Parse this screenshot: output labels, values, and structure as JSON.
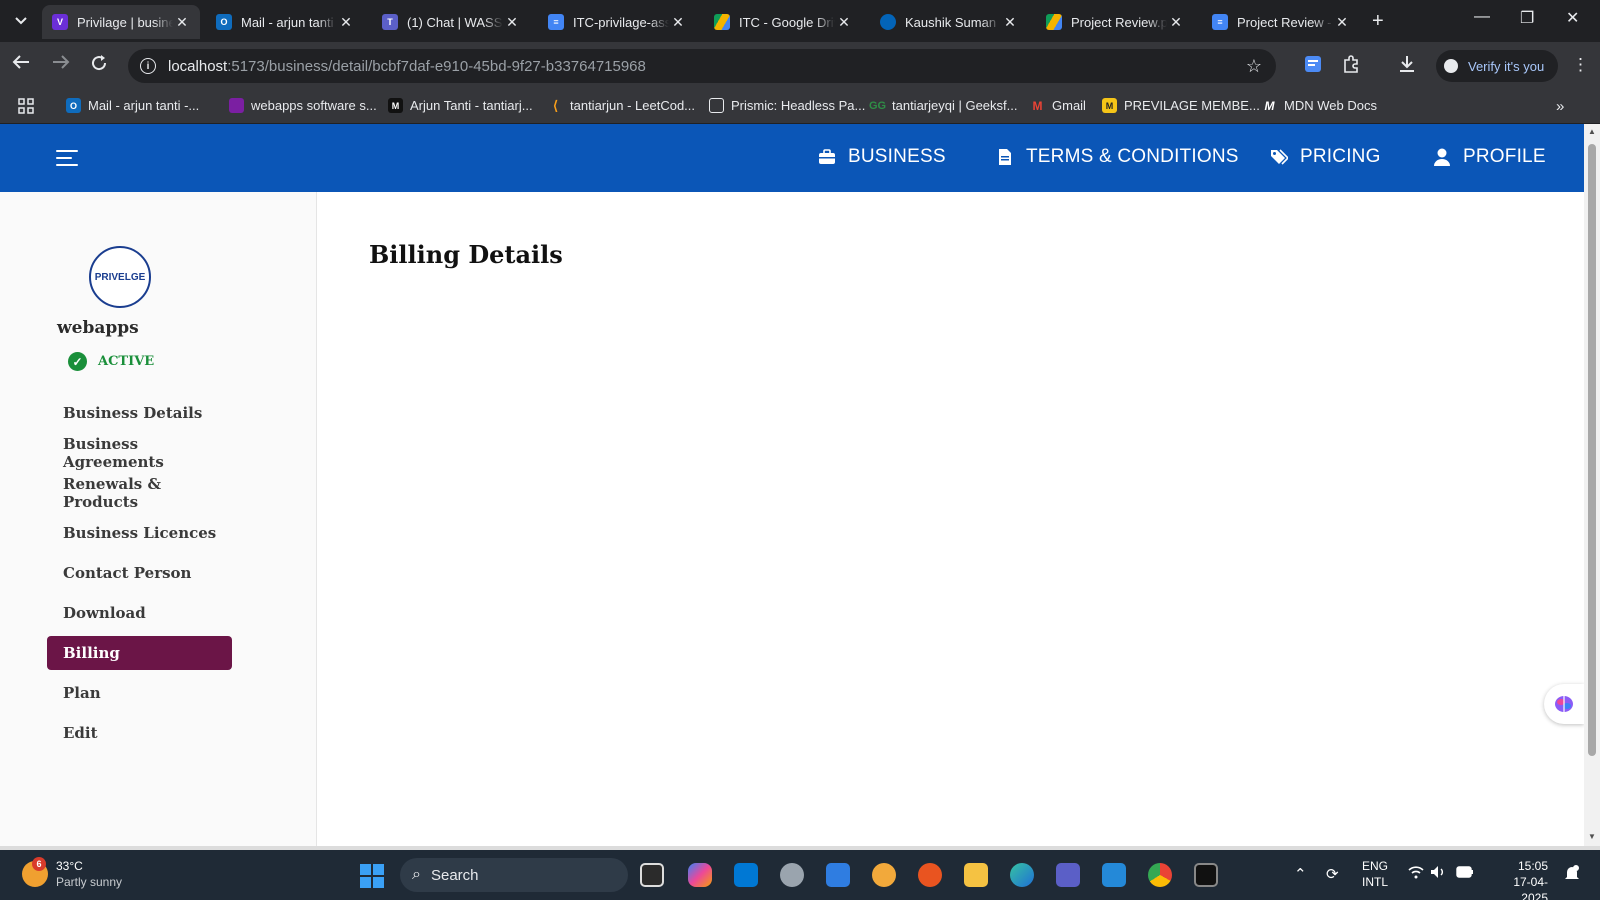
{
  "browser": {
    "tabs": [
      {
        "title": "Privilage | busine",
        "active": true,
        "icon": "vite-icon"
      },
      {
        "title": "Mail - arjun tanti",
        "icon": "outlook-icon"
      },
      {
        "title": "(1) Chat | WASS",
        "icon": "teams-icon"
      },
      {
        "title": "ITC-privilage-ass",
        "icon": "docs-icon"
      },
      {
        "title": "ITC - Google Driv",
        "icon": "drive-icon"
      },
      {
        "title": "Kaushik Suman",
        "icon": "onedrive-icon"
      },
      {
        "title": "Project Review.p",
        "icon": "drive-icon"
      },
      {
        "title": "Project Review -",
        "icon": "docs-icon"
      }
    ],
    "url_host": "localhost",
    "url_path": ":5173/business/detail/bcbf7daf-e910-45bd-9f27-b33764715968",
    "verify_label": "Verify it's you",
    "bookmarks": [
      "Mail - arjun tanti -...",
      "webapps software s...",
      "Arjun Tanti - tantiarj...",
      "tantiarjun - LeetCod...",
      "Prismic: Headless Pa...",
      "tantiarjeyqi | Geeksf...",
      "Gmail",
      "PREVILAGE MEMBE...",
      "MDN Web Docs"
    ]
  },
  "app": {
    "nav": {
      "business": "BUSINESS",
      "terms": "TERMS & CONDITIONS",
      "pricing": "PRICING",
      "profile": "PROFILE"
    },
    "logo_text": "PRIVELGE",
    "business_name": "webapps",
    "status": "ACTIVE",
    "menu": [
      "Business Details",
      "Business Agreements",
      "Renewals & Products",
      "Business Licences",
      "Contact Person",
      "Download",
      "Billing",
      "Plan",
      "Edit"
    ],
    "active_menu": "Billing",
    "page_title": "Billing Details"
  },
  "taskbar": {
    "temperature": "33°C",
    "weather": "Partly sunny",
    "weather_badge": "6",
    "search_placeholder": "Search",
    "lang_top": "ENG",
    "lang_bottom": "INTL",
    "time": "15:05",
    "date": "17-04-2025"
  },
  "colors": {
    "appbar": "#0b56b7",
    "active_menu": "#6b1547",
    "status_green": "#1a8f3a"
  }
}
